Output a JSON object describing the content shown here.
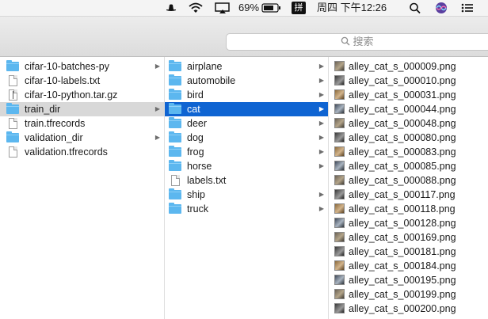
{
  "menubar": {
    "battery_percent": "69%",
    "input_method": "拼",
    "clock": "周四 下午12:26"
  },
  "search": {
    "placeholder": "搜索"
  },
  "column1": [
    {
      "label": "cifar-10-batches-py",
      "kind": "folder",
      "arrow": true
    },
    {
      "label": "cifar-10-labels.txt",
      "kind": "doc",
      "arrow": false
    },
    {
      "label": "cifar-10-python.tar.gz",
      "kind": "zip",
      "arrow": false
    },
    {
      "label": "train_dir",
      "kind": "folder",
      "arrow": true,
      "selected": "gray"
    },
    {
      "label": "train.tfrecords",
      "kind": "doc",
      "arrow": false
    },
    {
      "label": "validation_dir",
      "kind": "folder",
      "arrow": true
    },
    {
      "label": "validation.tfrecords",
      "kind": "doc",
      "arrow": false
    }
  ],
  "column2": [
    {
      "label": "airplane",
      "kind": "folder",
      "arrow": true
    },
    {
      "label": "automobile",
      "kind": "folder",
      "arrow": true
    },
    {
      "label": "bird",
      "kind": "folder",
      "arrow": true
    },
    {
      "label": "cat",
      "kind": "folder",
      "arrow": true,
      "selected": "blue"
    },
    {
      "label": "deer",
      "kind": "folder",
      "arrow": true
    },
    {
      "label": "dog",
      "kind": "folder",
      "arrow": true
    },
    {
      "label": "frog",
      "kind": "folder",
      "arrow": true
    },
    {
      "label": "horse",
      "kind": "folder",
      "arrow": true
    },
    {
      "label": "labels.txt",
      "kind": "doc",
      "arrow": false
    },
    {
      "label": "ship",
      "kind": "folder",
      "arrow": true
    },
    {
      "label": "truck",
      "kind": "folder",
      "arrow": true
    }
  ],
  "column3": [
    "alley_cat_s_000009.png",
    "alley_cat_s_000010.png",
    "alley_cat_s_000031.png",
    "alley_cat_s_000044.png",
    "alley_cat_s_000048.png",
    "alley_cat_s_000080.png",
    "alley_cat_s_000083.png",
    "alley_cat_s_000085.png",
    "alley_cat_s_000088.png",
    "alley_cat_s_000117.png",
    "alley_cat_s_000118.png",
    "alley_cat_s_000128.png",
    "alley_cat_s_000169.png",
    "alley_cat_s_000181.png",
    "alley_cat_s_000184.png",
    "alley_cat_s_000195.png",
    "alley_cat_s_000199.png",
    "alley_cat_s_000200.png"
  ],
  "colors": {
    "selection_blue": "#0f64d2",
    "selection_gray": "#d8d8d8",
    "folder": "#5cb7ef"
  }
}
